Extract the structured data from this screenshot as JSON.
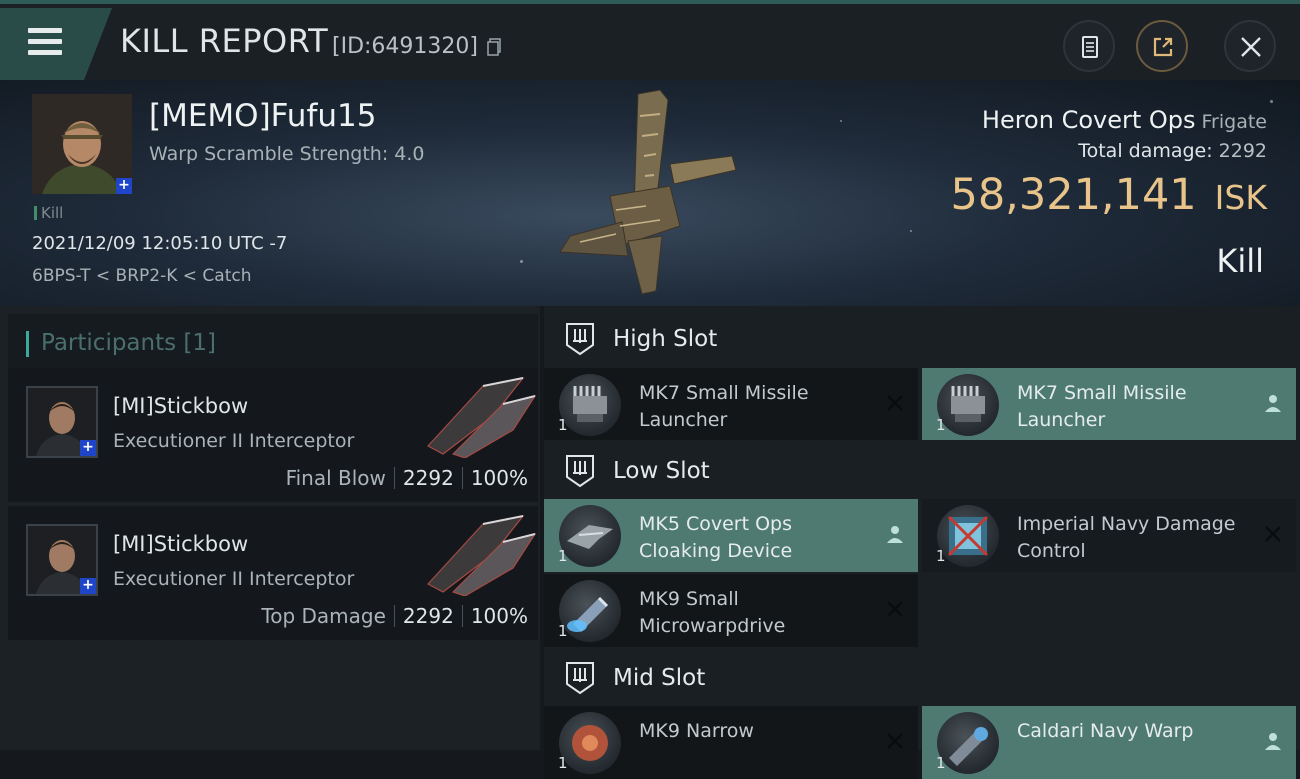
{
  "header": {
    "title": "KILL REPORT",
    "report_id": "[ID:6491320]",
    "menu_icon": "hamburger-icon",
    "copy_icon": "copy-icon",
    "actions": [
      {
        "name": "clipboard-report-button",
        "icon": "clipboard-icon"
      },
      {
        "name": "share-button",
        "icon": "share-icon"
      },
      {
        "name": "close-button",
        "icon": "close-icon"
      }
    ]
  },
  "victim": {
    "name": "[MEMO]Fufu15",
    "warp_scramble": "Warp Scramble Strength: 4.0",
    "tag": "Kill",
    "datetime": "2021/12/09 12:05:10 UTC -7",
    "location": "6BPS-T < BRP2-K < Catch",
    "ship_name": "Heron Covert Ops",
    "ship_class": "Frigate",
    "total_damage_label": "Total damage:",
    "total_damage": "2292",
    "isk_value": "58,321,141",
    "isk_unit": "ISK",
    "result": "Kill"
  },
  "participants": {
    "title": "Participants",
    "count": "[1]",
    "rows": [
      {
        "name": "[MI]Stickbow",
        "ship": "Executioner II Interceptor",
        "role": "Final Blow",
        "damage": "2292",
        "percent": "100%"
      },
      {
        "name": "[MI]Stickbow",
        "ship": "Executioner II Interceptor",
        "role": "Top Damage",
        "damage": "2292",
        "percent": "100%"
      }
    ]
  },
  "slots": {
    "high": {
      "title": "High Slot",
      "modules": [
        {
          "name": "MK7 Small Missile Launcher",
          "qty": "1",
          "status": "destroyed"
        },
        {
          "name": "MK7 Small Missile Launcher",
          "qty": "1",
          "status": "dropped"
        }
      ]
    },
    "low": {
      "title": "Low Slot",
      "modules": [
        {
          "name": "MK5 Covert Ops Cloaking Device",
          "qty": "1",
          "status": "dropped"
        },
        {
          "name": "Imperial Navy Damage Control",
          "qty": "1",
          "status": "destroyed"
        },
        {
          "name": "MK9 Small Microwarpdrive",
          "qty": "1",
          "status": "destroyed"
        }
      ]
    },
    "mid": {
      "title": "Mid Slot",
      "modules": [
        {
          "name": "MK9 Narrow",
          "qty": "1",
          "status": "destroyed"
        },
        {
          "name": "Caldari Navy Warp",
          "qty": "1",
          "status": "dropped"
        }
      ]
    }
  },
  "colors": {
    "accent_teal": "#4f7a72",
    "isk_gold": "#e8c48a",
    "badge_blue": "#1f45c8"
  }
}
